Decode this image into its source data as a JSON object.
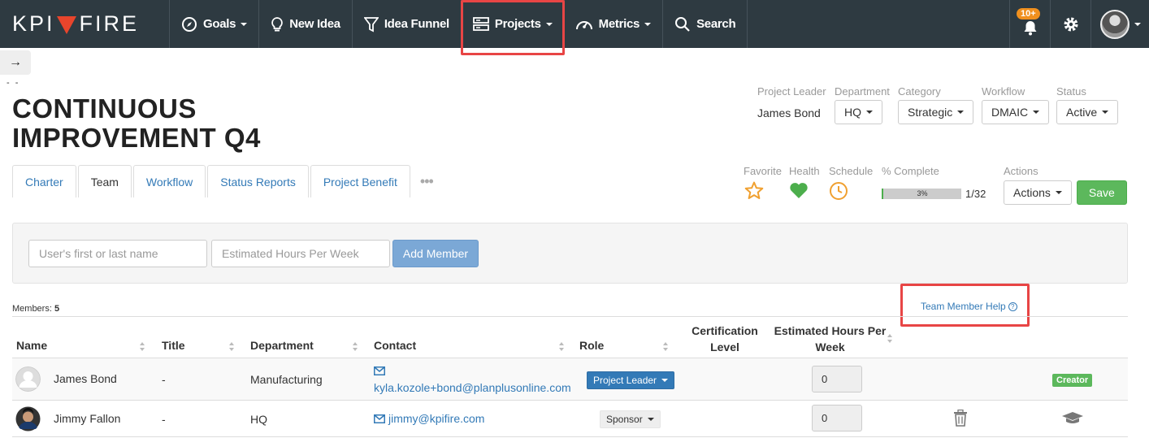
{
  "nav": {
    "logo_left": "KPI",
    "logo_right": "FIRE",
    "items": [
      {
        "label": "Goals"
      },
      {
        "label": "New Idea"
      },
      {
        "label": "Idea Funnel"
      },
      {
        "label": "Projects"
      },
      {
        "label": "Metrics"
      },
      {
        "label": "Search"
      }
    ],
    "notification_count": "10+"
  },
  "page": {
    "title": "CONTINUOUS IMPROVEMENT Q4",
    "dashes": "- -"
  },
  "tabs": [
    "Charter",
    "Team",
    "Workflow",
    "Status Reports",
    "Project Benefit"
  ],
  "meta": {
    "project_leader_label": "Project Leader",
    "project_leader_value": "James Bond",
    "department_label": "Department",
    "department_value": "HQ",
    "category_label": "Category",
    "category_value": "Strategic",
    "workflow_label": "Workflow",
    "workflow_value": "DMAIC",
    "status_label": "Status",
    "status_value": "Active",
    "favorite_label": "Favorite",
    "health_label": "Health",
    "schedule_label": "Schedule",
    "complete_label": "% Complete",
    "complete_value": "3%",
    "complete_fraction": 0.03,
    "complete_count": "1/32",
    "actions_label": "Actions",
    "actions_button": "Actions",
    "save_button": "Save"
  },
  "add_member": {
    "name_placeholder": "User's first or last name",
    "hours_placeholder": "Estimated Hours Per Week",
    "button": "Add Member"
  },
  "members": {
    "label": "Members:",
    "count": "5",
    "help_link": "Team Member Help"
  },
  "table": {
    "headers": {
      "name": "Name",
      "title": "Title",
      "department": "Department",
      "contact": "Contact",
      "role": "Role",
      "cert_line1": "Certification",
      "cert_line2": "Level",
      "hours_line1": "Estimated Hours Per",
      "hours_line2": "Week"
    },
    "rows": [
      {
        "name": "James Bond",
        "title": "-",
        "department": "Manufacturing",
        "contact": "kyla.kozole+bond@planplusonline.com",
        "role": "Project Leader",
        "hours": "0",
        "badge": "Creator"
      },
      {
        "name": "Jimmy Fallon",
        "title": "-",
        "department": "HQ",
        "contact": "jimmy@kpifire.com",
        "role": "Sponsor",
        "hours": "0"
      }
    ]
  },
  "colors": {
    "nav_bg": "#2e3a41",
    "accent_red": "#e84545",
    "link_blue": "#337ab7",
    "save_green": "#5cb85c",
    "health_green": "#4cae4c",
    "star_orange": "#f0a030"
  }
}
